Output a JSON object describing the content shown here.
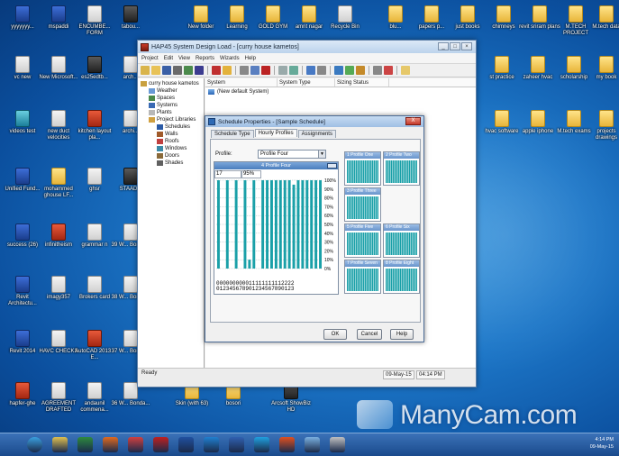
{
  "desktop_icons": [
    {
      "label": "yyyyyyy...",
      "kind": "blue"
    },
    {
      "label": "mspaddi",
      "kind": "blue"
    },
    {
      "label": "ENCUMBE... FORM",
      "kind": "doc"
    },
    {
      "label": "tabou...",
      "kind": "dark"
    },
    {
      "label": "New folder",
      "kind": "folder"
    },
    {
      "label": "Learning",
      "kind": "folder"
    },
    {
      "label": "GOLD GYM",
      "kind": "folder"
    },
    {
      "label": "amrit nagar",
      "kind": "folder"
    },
    {
      "label": "Recycle Bin",
      "kind": "doc"
    },
    {
      "label": "blu...",
      "kind": "folder"
    },
    {
      "label": "papers p...",
      "kind": "folder"
    },
    {
      "label": "just books",
      "kind": "folder"
    },
    {
      "label": "chimneys",
      "kind": "folder"
    },
    {
      "label": "revit sriram plans",
      "kind": "folder"
    },
    {
      "label": "M.TECH PROJECT",
      "kind": "folder"
    },
    {
      "label": "M.tech data",
      "kind": "folder"
    },
    {
      "label": "vc new",
      "kind": "doc"
    },
    {
      "label": "New Microsoft...",
      "kind": "doc"
    },
    {
      "label": "es25edtb...",
      "kind": "dark"
    },
    {
      "label": "arch...",
      "kind": "doc"
    },
    {
      "label": "st practice",
      "kind": "folder"
    },
    {
      "label": "zaheer hvac",
      "kind": "folder"
    },
    {
      "label": "scholarship",
      "kind": "folder"
    },
    {
      "label": "my book",
      "kind": "folder"
    },
    {
      "label": "videos test",
      "kind": "teal"
    },
    {
      "label": "new duct velocities",
      "kind": "doc"
    },
    {
      "label": "kitchen layout pla...",
      "kind": "red"
    },
    {
      "label": "archi...",
      "kind": "doc"
    },
    {
      "label": "hvac software",
      "kind": "folder"
    },
    {
      "label": "apple iphone",
      "kind": "folder"
    },
    {
      "label": "M.tech exams",
      "kind": "folder"
    },
    {
      "label": "projects drawings",
      "kind": "folder"
    },
    {
      "label": "Unified Fund...",
      "kind": "blue"
    },
    {
      "label": "mohammed ghouse LF...",
      "kind": "folder"
    },
    {
      "label": "ghsr",
      "kind": "doc"
    },
    {
      "label": "STAAD...",
      "kind": "dark"
    },
    {
      "label": "success (26)",
      "kind": "blue"
    },
    {
      "label": "infinitheism",
      "kind": "red"
    },
    {
      "label": "grammar n",
      "kind": "doc"
    },
    {
      "label": "39 W... Bonda...",
      "kind": "doc"
    },
    {
      "label": "Revit Architectu...",
      "kind": "blue"
    },
    {
      "label": "imagy357",
      "kind": "doc"
    },
    {
      "label": "Brokers card",
      "kind": "doc"
    },
    {
      "label": "38 W... Bonda...",
      "kind": "doc"
    },
    {
      "label": "Revit 2014",
      "kind": "blue"
    },
    {
      "label": "HAVC CHECKS",
      "kind": "doc"
    },
    {
      "label": "AutoCAD 2013 - E...",
      "kind": "red"
    },
    {
      "label": "37 W... Bonda...",
      "kind": "doc"
    },
    {
      "label": "hapfer-ghe",
      "kind": "red"
    },
    {
      "label": "AGREEMENT DRAFTED",
      "kind": "doc"
    },
    {
      "label": "andaunil commena...",
      "kind": "doc"
    },
    {
      "label": "36 W... Bonda...",
      "kind": "doc"
    },
    {
      "label": "Skin (with 63)",
      "kind": "folder"
    },
    {
      "label": "bosori",
      "kind": "folder"
    },
    {
      "label": "Arcsoft ShowBiz HD",
      "kind": "dark"
    }
  ],
  "window": {
    "title": "HAP45 System Design Load - [curry house kametos]",
    "menu": [
      "Project",
      "Edit",
      "View",
      "Reports",
      "Wizards",
      "Help"
    ],
    "tree": [
      {
        "label": "curry house kametos",
        "level": 0
      },
      {
        "label": "Weather",
        "level": 1
      },
      {
        "label": "Spaces",
        "level": 1
      },
      {
        "label": "Systems",
        "level": 1
      },
      {
        "label": "Plants",
        "level": 1
      },
      {
        "label": "Project Libraries",
        "level": 1
      },
      {
        "label": "Schedules",
        "level": 2
      },
      {
        "label": "Walls",
        "level": 2
      },
      {
        "label": "Roofs",
        "level": 2
      },
      {
        "label": "Windows",
        "level": 2
      },
      {
        "label": "Doors",
        "level": 2
      },
      {
        "label": "Shades",
        "level": 2
      }
    ],
    "columns": [
      "System",
      "System Type",
      "Sizing Status"
    ],
    "rows": [
      "(New default System)"
    ],
    "status": {
      "ready": "Ready",
      "date": "09-May-15",
      "time": "04:14 PM"
    }
  },
  "dialog": {
    "title": "Schedule Properties - [Sample Schedule]",
    "close": "X",
    "tabs": [
      "Schedule Type",
      "Hourly Profiles",
      "Assignments"
    ],
    "active_tab": 1,
    "profile_label": "Profile:",
    "profile_value": "Profile Four",
    "chart_title": "4 Profile Four",
    "hour_value": "17",
    "percent_value": "95",
    "percent_unit": "%",
    "y_ticks": [
      "100%",
      "90%",
      "80%",
      "70%",
      "60%",
      "50%",
      "40%",
      "30%",
      "20%",
      "10%",
      "0%"
    ],
    "hour_tens": "000000000011111111112222",
    "hour_units": "012345678901234567890123",
    "profile_thumbs": [
      "1 Profile One",
      "2 Profile Two",
      "3 Profile Three",
      "4 Profile Four",
      "5 Profile Five",
      "6 Profile Six",
      "7 Profile Seven",
      "8 Profile Eight"
    ],
    "buttons": {
      "ok": "OK",
      "cancel": "Cancel",
      "help": "Help"
    }
  },
  "chart_data": {
    "type": "bar",
    "title": "4 Profile Four",
    "categories": [
      "0",
      "1",
      "2",
      "3",
      "4",
      "5",
      "6",
      "7",
      "8",
      "9",
      "10",
      "11",
      "12",
      "13",
      "14",
      "15",
      "16",
      "17",
      "18",
      "19",
      "20",
      "21",
      "22",
      "23"
    ],
    "values": [
      100,
      0,
      100,
      0,
      100,
      0,
      100,
      10,
      100,
      0,
      100,
      100,
      100,
      100,
      100,
      100,
      100,
      95,
      100,
      100,
      100,
      100,
      100,
      100
    ],
    "ylim": [
      0,
      100
    ],
    "ylabel": "",
    "xlabel": "",
    "grid": true,
    "bar_color": "#1aa0a8"
  },
  "taskbar": {
    "apps": [
      "start",
      "explorer",
      "excel",
      "firefox",
      "chrome",
      "acrobat",
      "revit",
      "ie",
      "word",
      "skype",
      "chrome2",
      "paint",
      "hap"
    ],
    "time": "4:14 PM",
    "date": "09-May-15"
  },
  "watermark": "ManyCam.com"
}
